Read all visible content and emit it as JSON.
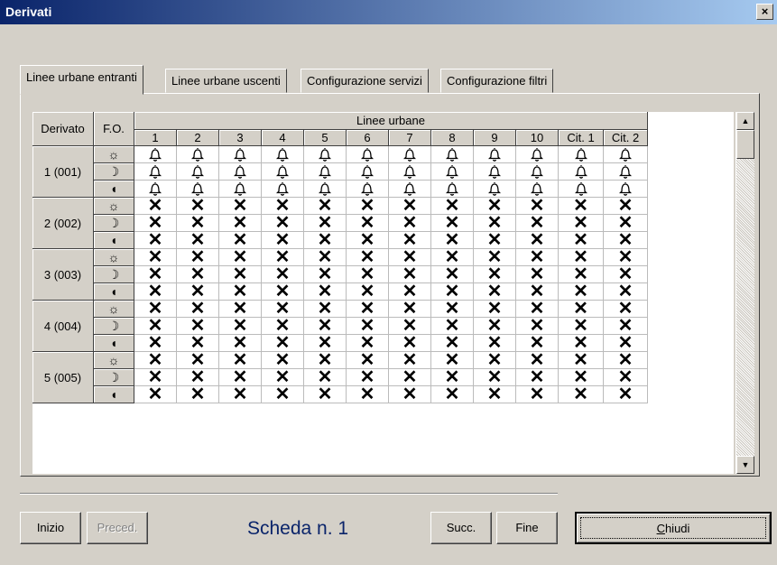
{
  "window": {
    "title": "Derivati",
    "close_label": "×"
  },
  "tabs": [
    {
      "label": "Linee urbane entranti",
      "active": true
    },
    {
      "label": "Linee urbane uscenti",
      "active": false
    },
    {
      "label": "Configurazione servizi",
      "active": false
    },
    {
      "label": "Configurazione filtri",
      "active": false
    }
  ],
  "grid": {
    "header_derivato": "Derivato",
    "header_fo": "F.O.",
    "header_linee": "Linee urbane",
    "columns": [
      "1",
      "2",
      "3",
      "4",
      "5",
      "6",
      "7",
      "8",
      "9",
      "10",
      "Cit. 1",
      "Cit. 2"
    ],
    "fo_icons": [
      {
        "name": "sun-icon",
        "glyph": "☼"
      },
      {
        "name": "moon-icon",
        "glyph": "☽"
      },
      {
        "name": "half-moon-icon",
        "glyph": "◖"
      }
    ],
    "bell_glyph": "♫",
    "bell_icon_glyph": "🔔",
    "x_glyph": "✕",
    "derivati": [
      {
        "label": "1 (001)",
        "state": "bell"
      },
      {
        "label": "2 (002)",
        "state": "x"
      },
      {
        "label": "3 (003)",
        "state": "x"
      },
      {
        "label": "4 (004)",
        "state": "x"
      },
      {
        "label": "5 (005)",
        "state": "x"
      }
    ]
  },
  "scrollbar": {
    "up_glyph": "▲",
    "down_glyph": "▼"
  },
  "footer": {
    "inizio": "Inizio",
    "preced": "Preced.",
    "scheda": "Scheda n. 1",
    "succ": "Succ.",
    "fine": "Fine",
    "chiudi_first": "C",
    "chiudi_rest": "hiudi"
  }
}
